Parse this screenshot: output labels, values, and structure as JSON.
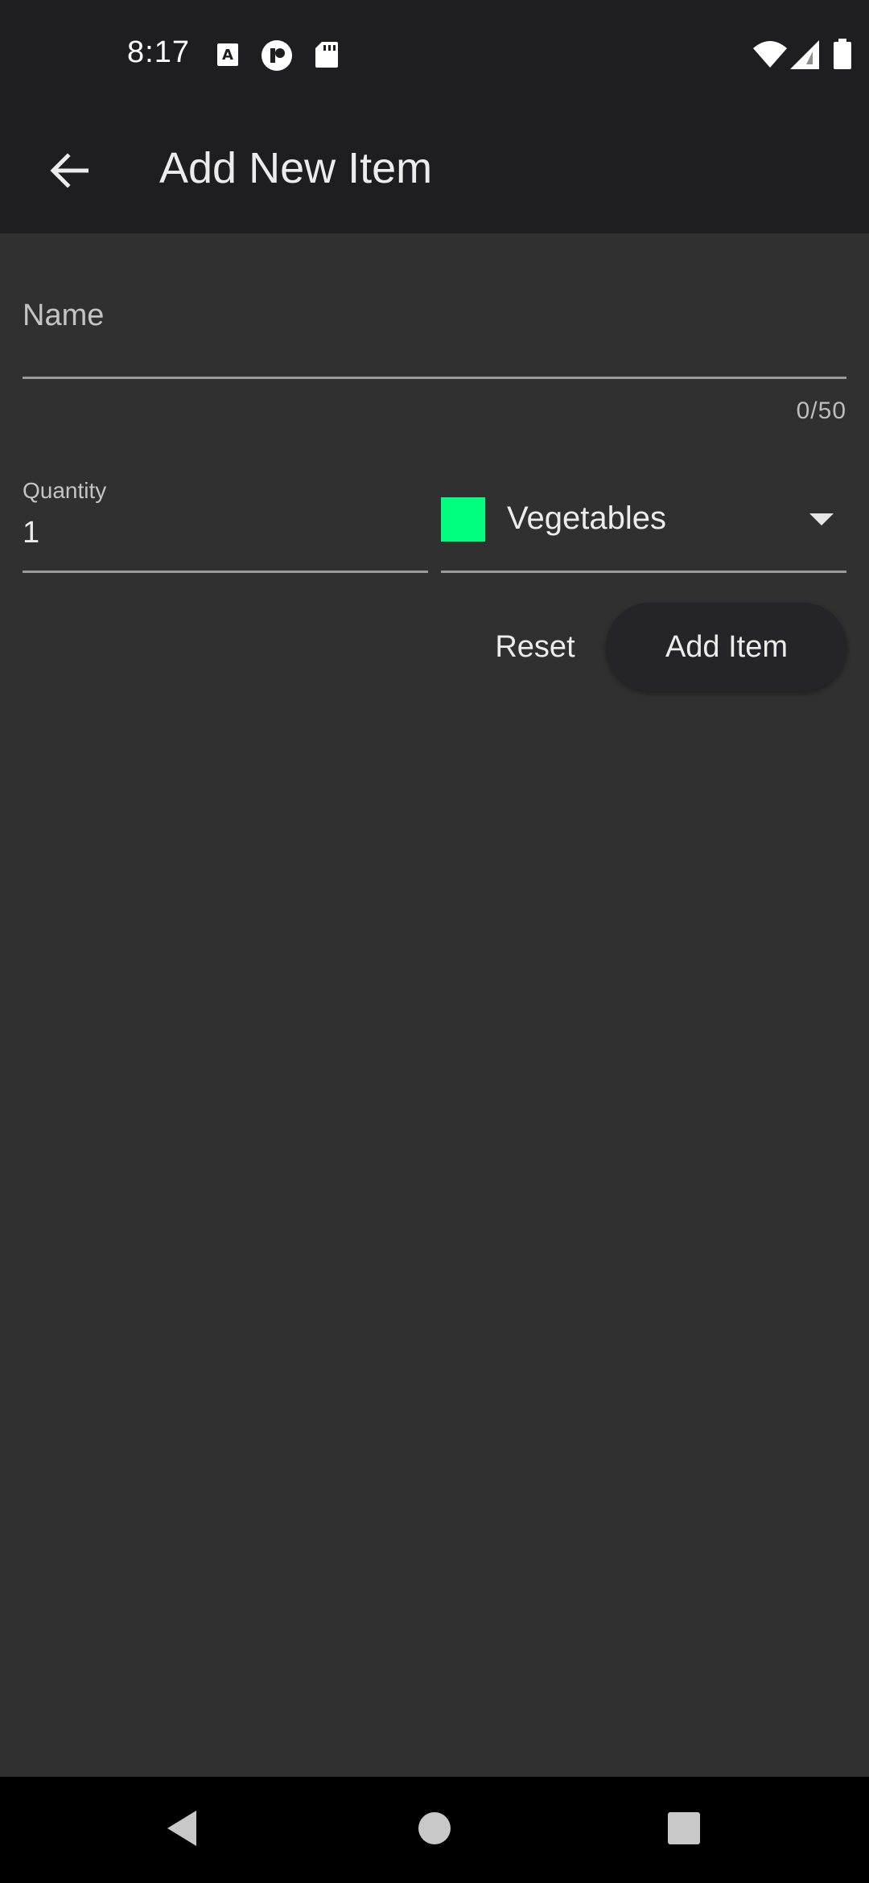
{
  "status_bar": {
    "time": "8:17",
    "left_icons": [
      "font-a-icon",
      "pocket-icon",
      "sd-card-icon"
    ],
    "right_icons": [
      "wifi-icon",
      "signal-icon",
      "battery-icon"
    ]
  },
  "app_bar": {
    "back_icon": "arrow-left-icon",
    "title": "Add New Item"
  },
  "form": {
    "name": {
      "label": "Name",
      "value": "",
      "counter": "0/50"
    },
    "quantity": {
      "label": "Quantity",
      "value": "1"
    },
    "category": {
      "selected": "Vegetables",
      "swatch_color": "#00ff7f",
      "arrow_icon": "dropdown-arrow-icon"
    },
    "actions": {
      "reset_label": "Reset",
      "add_label": "Add Item"
    }
  },
  "nav_bar": {
    "back": "triangle-back-icon",
    "home": "circle-home-icon",
    "recents": "square-recents-icon"
  }
}
